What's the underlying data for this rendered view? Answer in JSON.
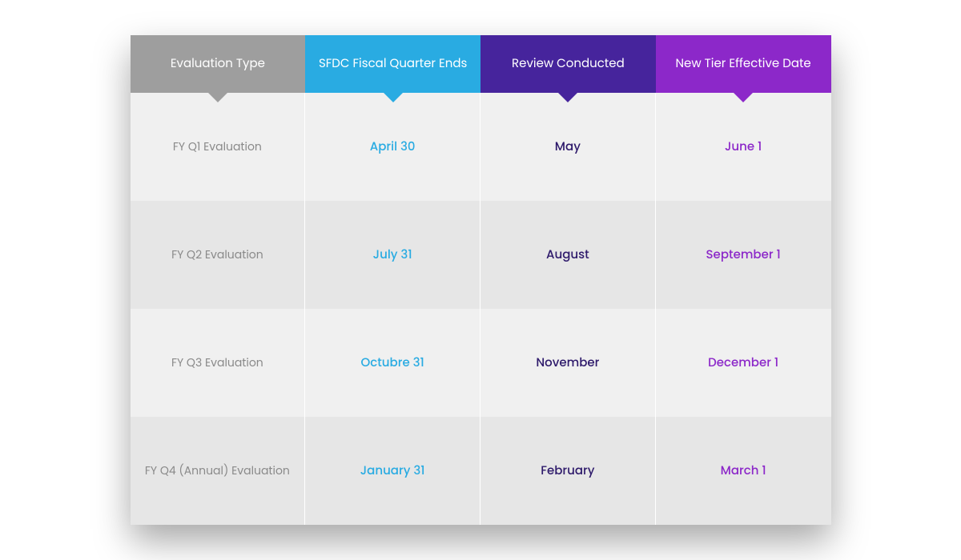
{
  "headers": [
    "Evaluation Type",
    "SFDC Fiscal Quarter Ends",
    "Review Conducted",
    "New Tier Effective Date"
  ],
  "rows": [
    {
      "evaluation_type": "FY Q1 Evaluation",
      "fiscal_quarter_ends": "April 30",
      "review_conducted": "May",
      "effective_date": "June 1"
    },
    {
      "evaluation_type": "FY Q2 Evaluation",
      "fiscal_quarter_ends": "July 31",
      "review_conducted": "August",
      "effective_date": "September 1"
    },
    {
      "evaluation_type": "FY Q3 Evaluation",
      "fiscal_quarter_ends": "Octubre 31",
      "review_conducted": "November",
      "effective_date": "December 1"
    },
    {
      "evaluation_type": "FY Q4 (Annual) Evaluation",
      "fiscal_quarter_ends": "January 31",
      "review_conducted": "February",
      "effective_date": "March 1"
    }
  ]
}
